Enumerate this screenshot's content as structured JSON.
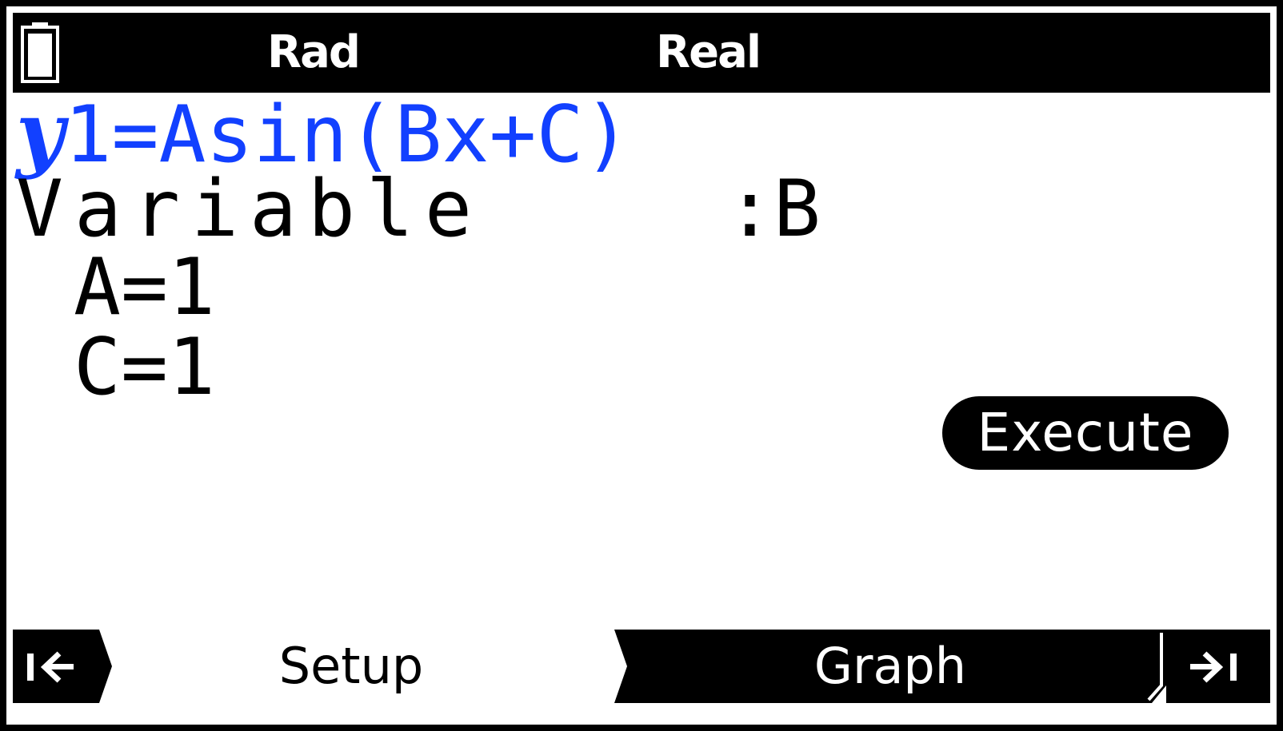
{
  "status_bar": {
    "angle_unit": "Rad",
    "complex_mode": "Real"
  },
  "function": {
    "y_symbol": "y",
    "expression": "1=Asin(Bx+C)",
    "color": "#1240ff"
  },
  "variable": {
    "label": "Variable",
    "value": ":B"
  },
  "parameters": [
    {
      "text": "A=1"
    },
    {
      "text": "C=1"
    }
  ],
  "execute_button": {
    "label": "Execute"
  },
  "bottom_bar": {
    "left_icon": "skip-to-start-icon",
    "setup_label": "Setup",
    "graph_label": "Graph",
    "right_icon": "skip-to-end-icon"
  }
}
